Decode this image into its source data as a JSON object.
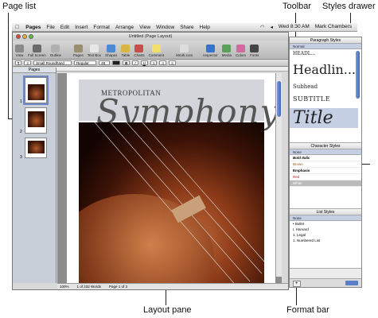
{
  "callouts": {
    "page_list": "Page list",
    "toolbar": "Toolbar",
    "styles_drawer": "Styles drawer",
    "layout_pane": "Layout pane",
    "format_bar": "Format bar"
  },
  "menubar": {
    "apple": "",
    "items": [
      "Pages",
      "File",
      "Edit",
      "Insert",
      "Format",
      "Arrange",
      "View",
      "Window",
      "Share",
      "Help"
    ],
    "clock": "Wed 8:30 AM",
    "user": "Mark Chambers"
  },
  "window": {
    "title": "Untitled (Page Layout)"
  },
  "toolbar": {
    "items": [
      {
        "label": "View",
        "color": "#8a8a8a"
      },
      {
        "label": "Full Screen",
        "color": "#6a6a6a"
      },
      {
        "label": "Outline",
        "color": "#b0b0b0"
      },
      {
        "label": "Pages",
        "color": "#9a8f6c"
      },
      {
        "label": "Text Box",
        "color": "#e8e8e8"
      },
      {
        "label": "Shapes",
        "color": "#4c8ad4"
      },
      {
        "label": "Table",
        "color": "#d8b447"
      },
      {
        "label": "Charts",
        "color": "#c84e4e"
      },
      {
        "label": "Comment",
        "color": "#f2e06a"
      },
      {
        "label": "iWork.com",
        "color": "#ddd"
      },
      {
        "label": "Inspector",
        "color": "#3b6fd0"
      },
      {
        "label": "Media",
        "color": "#5aa05a"
      },
      {
        "label": "Colors",
        "color": "#d06aa0"
      },
      {
        "label": "Fonts",
        "color": "#444"
      }
    ]
  },
  "formatbar": {
    "style": "Small Roundhand",
    "weight": "Regular",
    "size": "48"
  },
  "pages_panel": {
    "header": "Pages",
    "thumbs": [
      "1",
      "2",
      "3"
    ]
  },
  "document": {
    "metro": "METROPOLITAN",
    "title": "Symphony"
  },
  "status": {
    "zoom": "100%",
    "words": "1 of 232 Words",
    "page": "Page 1 of 3"
  },
  "drawer": {
    "paragraph_header": "Paragraph Styles",
    "paragraph_selected": "Normal",
    "paragraph_items": [
      "HEADL...",
      "Headlin...",
      "Subhead",
      "SUBTITLE",
      "Title"
    ],
    "character_header": "Character Styles",
    "character_selected": "None",
    "character_items": [
      "Bold Italic",
      "Brown",
      "Emphasis",
      "Red",
      "White"
    ],
    "list_header": "List Styles",
    "list_selected": "None",
    "list_items": [
      "• Bullet",
      "I. Harvard",
      "1. Legal",
      "1. Numbered List"
    ]
  }
}
